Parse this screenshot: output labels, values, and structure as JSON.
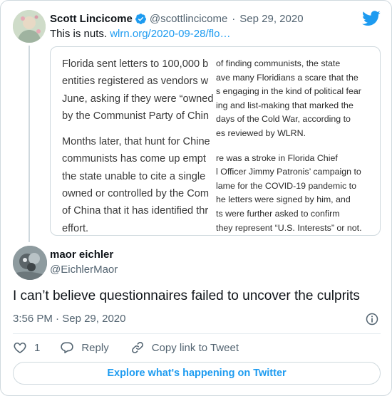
{
  "quoted_tweet": {
    "author_name": "Scott Lincicome",
    "handle": "@scottlincicome",
    "separator": "·",
    "date": "Sep 29, 2020",
    "text": "This is nuts.",
    "link": "wlrn.org/2020-09-28/flo…"
  },
  "article_image": {
    "left_paragraphs": [
      [
        "Florida sent letters to 100,000 b",
        "entities registered as vendors w",
        "June, asking if they were “owned",
        "by the Communist Party of Chin"
      ],
      [
        "Months later, that hunt for Chine",
        "communists has come up empt",
        "the state unable to cite a single",
        "owned or controlled by the Com",
        "of China that it has identified thr",
        "effort."
      ]
    ],
    "right_paragraphs": [
      [
        "of finding communists, the state",
        "ave many Floridians a scare that the",
        "s engaging in the kind of political fear",
        "ing and list-making that marked the",
        "days of the Cold War, according to",
        "es reviewed by WLRN."
      ],
      [
        "re was a stroke in Florida Chief",
        "l Officer Jimmy Patronis’ campaign to",
        "lame for the COVID-19 pandemic to",
        "he letters were signed by him, and",
        "ts were further asked to confirm",
        "they represent “U.S. Interests” or not."
      ]
    ]
  },
  "reply_tweet": {
    "author_name": "maor eichler",
    "handle": "@EichlerMaor",
    "text": "I can’t believe questionnaires failed to uncover the culprits",
    "time": "3:56 PM",
    "separator": "·",
    "date": "Sep 29, 2020"
  },
  "actions": {
    "like_count": "1",
    "reply_label": "Reply",
    "copy_link_label": "Copy link to Tweet"
  },
  "explore_button": "Explore what's happening on Twitter",
  "colors": {
    "accent": "#1d9bf0",
    "text": "#0f1419",
    "secondary": "#536471",
    "border": "#cfd9de"
  }
}
